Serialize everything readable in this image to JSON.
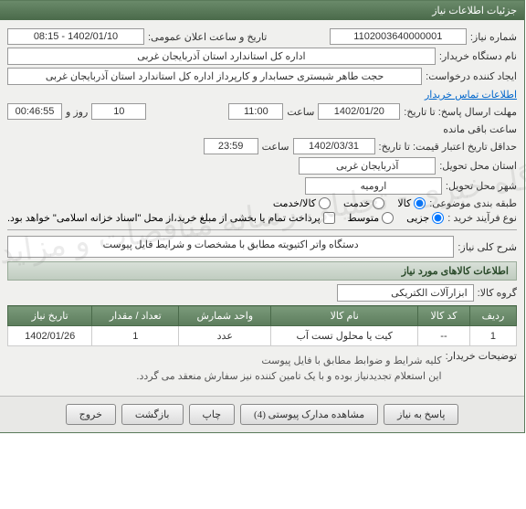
{
  "titlebar": "جزئیات اطلاعات نیاز",
  "labels": {
    "req_no": "شماره نیاز:",
    "announce": "تاریخ و ساعت اعلان عمومی:",
    "buyer_org": "نام دستگاه خریدار:",
    "requester": "ایجاد کننده درخواست:",
    "contact_info": "اطلاعات تماس خریدار",
    "deadline": "مهلت ارسال پاسخ: تا تاریخ:",
    "at_time": "ساعت",
    "days_and": "روز و",
    "remaining": "ساعت باقی مانده",
    "price_valid": "حداقل تاریخ اعتبار قیمت: تا تاریخ:",
    "delivery_prov": "استان محل تحویل:",
    "delivery_city": "شهر محل تحویل:",
    "subject_cat": "طبقه بندی موضوعی:",
    "purchase_proc": "نوع فرآیند خرید :",
    "purchase_note": "پرداخت تمام یا بخشی از مبلغ خرید،از محل \"اسناد خزانه اسلامی\" خواهد بود.",
    "desc": "شرح کلی نیاز:",
    "goods_info": "اطلاعات کالاهای مورد نیاز",
    "goods_group": "گروه کالا:",
    "buyer_notes": "توضیحات خریدار:"
  },
  "values": {
    "req_no": "1102003640000001",
    "announce": "1402/01/10 - 08:15",
    "buyer_org": "اداره کل استاندارد استان آذربایجان غربی",
    "requester": "حجت طاهر شبستری حسابدار و کارپرداز اداره کل استاندارد استان آذربایجان غربی",
    "deadline_date": "1402/01/20",
    "deadline_time": "11:00",
    "days_left": "10",
    "time_left": "00:46:55",
    "price_valid_date": "1402/03/31",
    "price_valid_time": "23:59",
    "province": "آذربایجان غربی",
    "city": "ارومیه",
    "desc": "دستگاه واتر اکتیویته مطابق با مشخصات و شرایط فایل پیوست",
    "goods_group": "ابزارآلات الکتریکی",
    "buyer_notes": "کلیه شرایط و ضوابط مطابق با فایل پیوست\nاین استعلام تجدیدنیاز بوده و با یک تامین کننده نیز سفارش منعقد می گردد."
  },
  "radios": {
    "subject": [
      {
        "label": "کالا",
        "checked": true
      },
      {
        "label": "خدمت",
        "checked": false
      },
      {
        "label": "کالا/خدمت",
        "checked": false
      }
    ],
    "purchase": [
      {
        "label": "جزیی",
        "checked": true
      },
      {
        "label": "متوسط",
        "checked": false
      }
    ]
  },
  "table": {
    "headers": [
      "ردیف",
      "کد کالا",
      "نام کالا",
      "واحد شمارش",
      "تعداد / مقدار",
      "تاریخ نیاز"
    ],
    "rows": [
      {
        "no": "1",
        "code": "--",
        "name": "کیت یا محلول تست آب",
        "unit": "عدد",
        "qty": "1",
        "date": "1402/01/26"
      }
    ]
  },
  "buttons": {
    "respond": "پاسخ به نیاز",
    "attachments": "مشاهده مدارک پیوستی (4)",
    "print": "چاپ",
    "back": "بازگشت",
    "exit": "خروج"
  },
  "watermark": "پایگاه خبری - تحلیلی رسانه مناقصات و مزایدات"
}
